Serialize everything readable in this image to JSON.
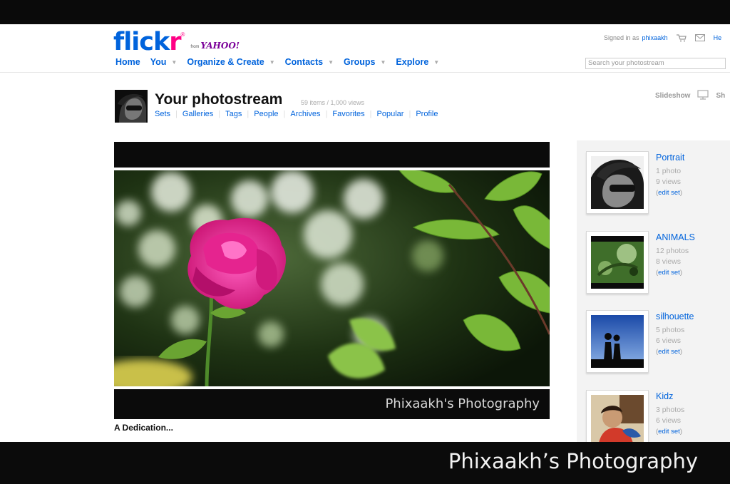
{
  "header": {
    "logo_flick": "flick",
    "logo_r": "r",
    "logo_from": "from",
    "logo_yahoo": "YAHOO!",
    "signed_in_label": "Signed in as",
    "username": "phixaakh",
    "help_label": "He",
    "search_placeholder": "Search your photostream",
    "colors": {
      "flickr_blue": "#0063dc",
      "flickr_pink": "#ff0084",
      "yahoo_purple": "#7b0099"
    }
  },
  "nav": [
    {
      "label": "Home",
      "has_menu": false
    },
    {
      "label": "You",
      "has_menu": true
    },
    {
      "label": "Organize & Create",
      "has_menu": true
    },
    {
      "label": "Contacts",
      "has_menu": true
    },
    {
      "label": "Groups",
      "has_menu": true
    },
    {
      "label": "Explore",
      "has_menu": true
    }
  ],
  "photostream": {
    "title": "Your photostream",
    "meta": "59 items / 1,000 views",
    "tabs": [
      "Sets",
      "Galleries",
      "Tags",
      "People",
      "Archives",
      "Favorites",
      "Popular",
      "Profile"
    ],
    "slideshow_label": "Slideshow",
    "share_label": "Sh"
  },
  "photo": {
    "watermark": "Phixaakh's Photography",
    "caption": "A Dedication..."
  },
  "sets": [
    {
      "name": "Portrait",
      "count": "1 photo",
      "views": "9 views",
      "edit": "edit set"
    },
    {
      "name": "ANIMALS",
      "count": "12 photos",
      "views": "8 views",
      "edit": "edit set"
    },
    {
      "name": "silhouette",
      "count": "5 photos",
      "views": "6 views",
      "edit": "edit set"
    },
    {
      "name": "Kidz",
      "count": "3 photos",
      "views": "6 views",
      "edit": "edit set"
    }
  ],
  "banner": {
    "text": "Phixaakh’s Photography"
  }
}
